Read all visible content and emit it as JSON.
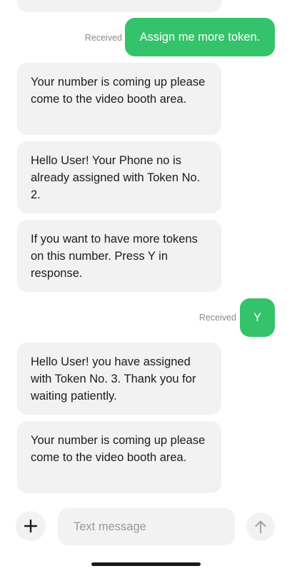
{
  "thread": {
    "messages": [
      {
        "direction": "in",
        "text": ""
      },
      {
        "direction": "out",
        "text": "Assign me more token.",
        "status": "Received"
      },
      {
        "direction": "in",
        "text": "Your number is coming up please come to the video booth area."
      },
      {
        "direction": "in",
        "text": "Hello User! Your Phone no is already assigned with Token No. 2."
      },
      {
        "direction": "in",
        "text": "If you want to have more tokens on this number. Press Y in response."
      },
      {
        "direction": "out",
        "text": "Y",
        "status": "Received"
      },
      {
        "direction": "in",
        "text": "Hello User! you have assigned with Token No. 3. Thank you for waiting patiently."
      },
      {
        "direction": "in",
        "text": "Your number is coming up please come to the video booth area."
      }
    ]
  },
  "composer": {
    "add_icon": "plus-icon",
    "placeholder": "Text message",
    "value": "",
    "send_icon": "arrow-up-icon"
  },
  "colors": {
    "outgoing_bubble": "#34c26a",
    "incoming_bubble": "#f2f2f2",
    "status_text": "#8a8a8a"
  }
}
